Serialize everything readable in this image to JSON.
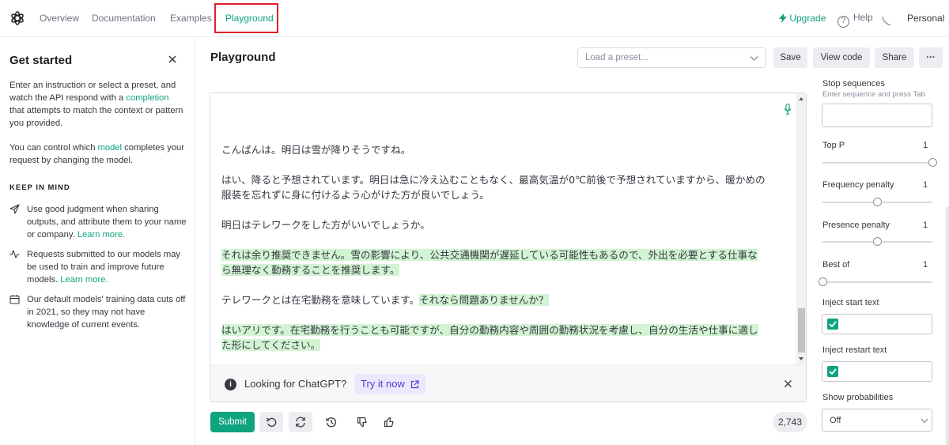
{
  "nav": {
    "items": [
      "Overview",
      "Documentation",
      "Examples",
      "Playground"
    ],
    "active": "Playground",
    "upgrade": "Upgrade",
    "help": "Help",
    "account": "Personal",
    "accent": "#10a37f",
    "highlight_color": "#e0202a"
  },
  "sidebar": {
    "title": "Get started",
    "intro_pre": "Enter an instruction or select a preset, and watch the API respond with a ",
    "intro_link": "completion",
    "intro_post": " that attempts to match the context or pattern you provided.",
    "model_pre": "You can control which ",
    "model_link": "model",
    "model_post": " completes your request by changing the model.",
    "keep_in_mind": "KEEP IN MIND",
    "tips": [
      {
        "icon": "send-icon",
        "text": "Use good judgment when sharing outputs, and attribute them to your name or company. ",
        "link": "Learn more."
      },
      {
        "icon": "activity-icon",
        "text": "Requests submitted to our models may be used to train and improve future models. ",
        "link": "Learn more."
      },
      {
        "icon": "calendar-icon",
        "text": "Our default models' training data cuts off in 2021, so they may not have knowledge of current events.",
        "link": ""
      }
    ]
  },
  "header": {
    "title": "Playground",
    "preset_placeholder": "Load a preset...",
    "buttons": [
      "Save",
      "View code",
      "Share",
      "···"
    ]
  },
  "editor": {
    "paragraphs": [
      {
        "segments": [
          {
            "text": "こんばんは。明日は雪が降りそうですね。",
            "highlight": false
          }
        ]
      },
      {
        "segments": [
          {
            "text": "はい、降ると予想されています。明日は急に冷え込むこともなく、最高気温が0℃前後で予想されていますから、暖かめの服装を忘れずに身に付けるよう心がけた方が良いでしょう。",
            "highlight": false
          }
        ]
      },
      {
        "segments": [
          {
            "text": "明日はテレワークをした方がいいでしょうか。",
            "highlight": false
          }
        ]
      },
      {
        "segments": [
          {
            "text": "それは余り推奨できません。雪の影響により、公共交通機関が遅延している可能性もあるので、外出を必要とする仕事なら無理なく勤務することを推奨します。",
            "highlight": true
          }
        ]
      },
      {
        "segments": [
          {
            "text": "テレワークとは在宅勤務を意味しています。",
            "highlight": false
          },
          {
            "text": "それなら問題ありませんか？",
            "highlight": true
          }
        ]
      },
      {
        "segments": [
          {
            "text": "はいアリです。在宅勤務を行うことも可能ですが、自分の勤務内容や周囲の勤務状況を考慮し、自分の生活や仕事に適した形にしてください。",
            "highlight": true
          }
        ]
      }
    ],
    "highlight_color": "#d2f4d3",
    "banner": {
      "message": "Looking for ChatGPT?",
      "cta": "Try it now"
    }
  },
  "footer": {
    "submit": "Submit",
    "token_count": "2,743"
  },
  "settings": {
    "stop_sequences": {
      "label": "Stop sequences",
      "hint": "Enter sequence and press Tab"
    },
    "sliders": [
      {
        "label": "Top P",
        "value": "1",
        "fraction": 1.0
      },
      {
        "label": "Frequency penalty",
        "value": "1",
        "fraction": 0.5
      },
      {
        "label": "Presence penalty",
        "value": "1",
        "fraction": 0.5
      },
      {
        "label": "Best of",
        "value": "1",
        "fraction": 0.0
      }
    ],
    "inject_start": {
      "label": "Inject start text",
      "checked": true
    },
    "inject_restart": {
      "label": "Inject restart text",
      "checked": true
    },
    "show_probabilities": {
      "label": "Show probabilities",
      "value": "Off"
    }
  }
}
